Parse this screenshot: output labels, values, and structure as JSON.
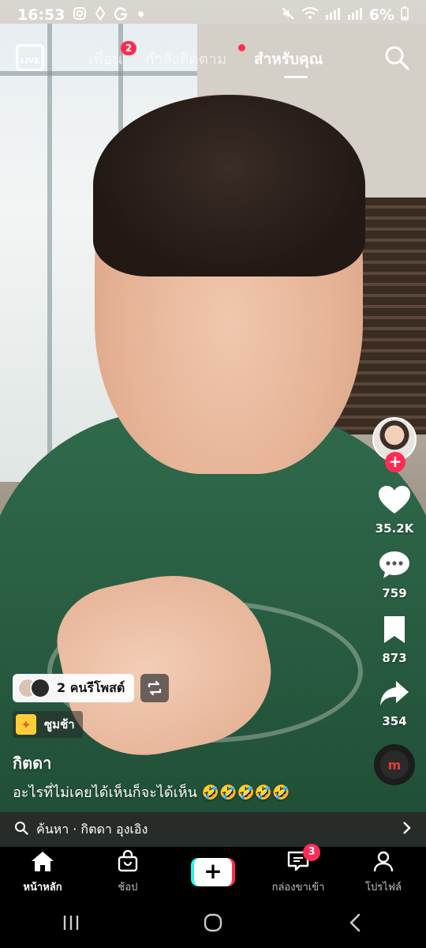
{
  "status_bar": {
    "time": "16:53",
    "notif_icons": [
      "instagram-icon",
      "feather-icon",
      "g-icon",
      "dot"
    ],
    "battery": "6%"
  },
  "top_tabs": {
    "live_label": "LIVE",
    "friends": "เพื่อน",
    "friends_badge": "2",
    "following": "กำลังติดตาม",
    "for_you": "สำหรับคุณ"
  },
  "actions": {
    "likes": "35.2K",
    "comments": "759",
    "saves": "873",
    "shares": "354"
  },
  "post": {
    "repost_label": "2 คนรีโพสต์",
    "effect_label": "ซูมช้า",
    "username": "กิตดา",
    "caption": "อะไรที่ไม่เคยได้เห็นก็จะได้เห็น 🤣🤣🤣🤣🤣"
  },
  "search_suggestion": {
    "text": "ค้นหา · กิตดา อุงเอิง"
  },
  "bottom_nav": {
    "home": "หน้าหลัก",
    "shop": "ช้อป",
    "create": "+",
    "inbox": "กล่องขาเข้า",
    "inbox_badge": "3",
    "profile": "โปรไฟล์"
  },
  "colors": {
    "accent": "#fe2c55",
    "cyan": "#25f4ee"
  }
}
